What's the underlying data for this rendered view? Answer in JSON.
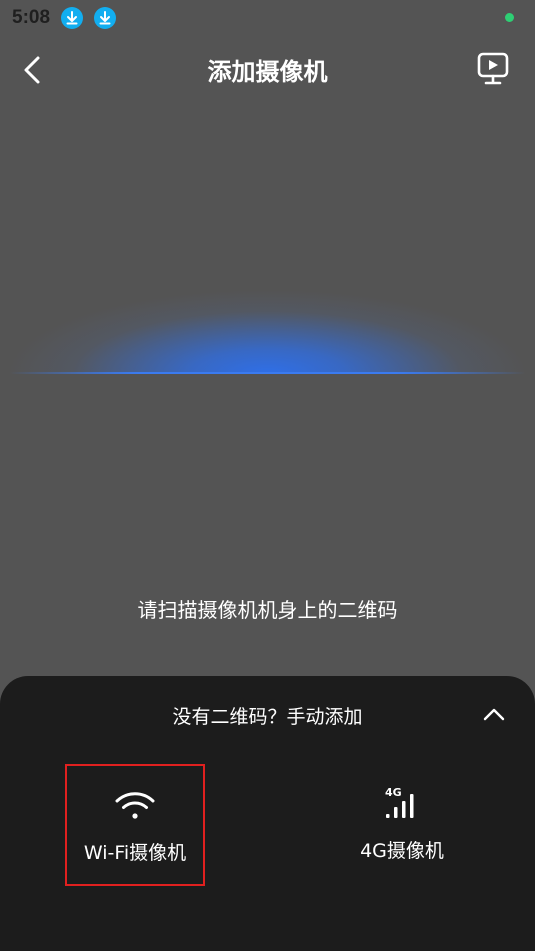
{
  "status_bar": {
    "time": "5:08",
    "icons": [
      "download-icon",
      "download-icon"
    ],
    "indicator_color": "#2ecf74"
  },
  "nav": {
    "title": "添加摄像机",
    "back_icon": "chevron-left-icon",
    "video_icon": "monitor-play-icon"
  },
  "scan": {
    "hint": "请扫描摄像机机身上的二维码",
    "glow_color": "#2f6fe8"
  },
  "panel": {
    "manual_add": "没有二维码？手动添加",
    "collapse_icon": "chevron-up-icon",
    "options": [
      {
        "label": "Wi-Fi摄像机",
        "icon": "wifi-icon",
        "highlighted": true
      },
      {
        "label": "4G摄像机",
        "icon": "signal-4g-icon",
        "highlighted": false
      }
    ]
  }
}
